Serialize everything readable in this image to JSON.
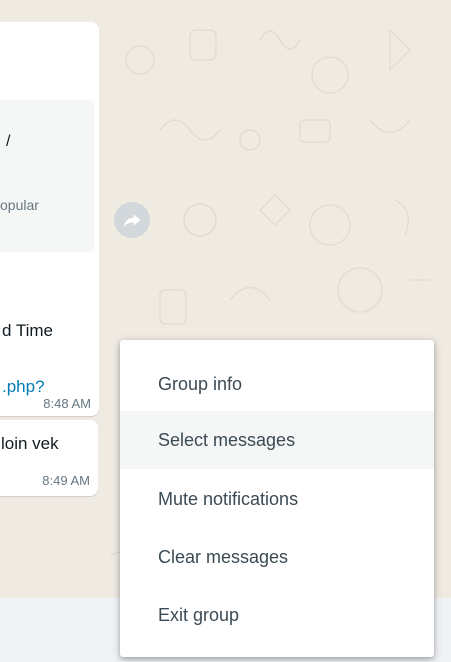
{
  "chat": {
    "link_preview": {
      "title_fragment": "/",
      "desc_fragment": "opular"
    },
    "message1": {
      "line1": "d Time",
      "link_fragment": ".php?",
      "time": "8:48 AM"
    },
    "message2": {
      "text": "loin vek",
      "time": "8:49 AM"
    },
    "forward_icon": "forward-arrow-icon"
  },
  "context_menu": {
    "items": [
      {
        "label": "Group info"
      },
      {
        "label": "Select messages"
      },
      {
        "label": "Mute notifications"
      },
      {
        "label": "Clear messages"
      },
      {
        "label": "Exit group"
      }
    ],
    "highlighted_index": 1
  },
  "colors": {
    "wallpaper": "#efeae2",
    "bubble": "#ffffff",
    "link": "#027eb5",
    "menu_text": "#3b4a54",
    "menu_hover": "#f5f6f6"
  }
}
